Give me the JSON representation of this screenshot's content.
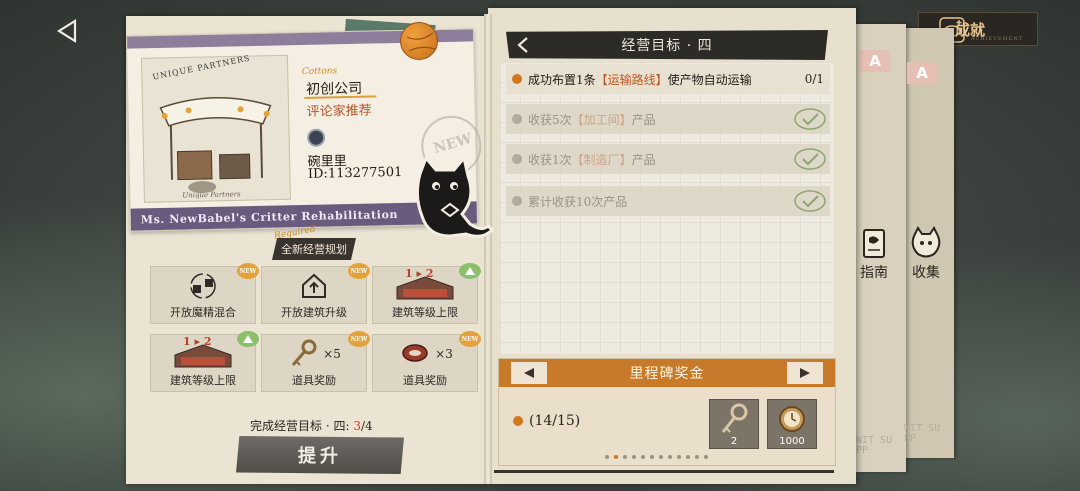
{
  "header": {
    "achievement_label": "成就",
    "achievement_sub": "ACHIEVEMENT"
  },
  "postcard": {
    "top_stamp": "UNIQUE PARTNERS",
    "company_deco": "Cottons",
    "company_name": "初创公司",
    "company_subtitle": "评论家推荐",
    "owner_name": "碗里里",
    "owner_id": "ID:113277501",
    "bottom_band": "Ms. NewBabel's Critter Rehabilitation",
    "stall_caption": "Unique Partners",
    "postmark_text": "NEW",
    "colors": {
      "accent": "#b5552b",
      "band": "#6a5a7e"
    }
  },
  "plan": {
    "deco": "Required",
    "title": "全新经营规划"
  },
  "tiles": [
    {
      "label": "开放魔精混合",
      "badge": "NEW",
      "icon": "swap-critters-icon"
    },
    {
      "label": "开放建筑升级",
      "badge": "NEW",
      "icon": "house-upgrade-icon"
    },
    {
      "label": "建筑等级上限",
      "badge": "up",
      "level": "1 ▸ 2",
      "icon": "building-level-icon"
    },
    {
      "label": "建筑等级上限",
      "badge": "up",
      "level": "1 ▸ 2",
      "icon": "building-level-icon"
    },
    {
      "label": "道具奖励",
      "badge": "NEW",
      "qty": "×5",
      "icon": "key-item-icon"
    },
    {
      "label": "道具奖励",
      "badge": "NEW",
      "qty": "×3",
      "icon": "meat-item-icon"
    }
  ],
  "completion": {
    "label": "完成经营目标 · 四: ",
    "current": "3",
    "sep": "/",
    "total": "4"
  },
  "upgrade_button": "提升",
  "goals": {
    "title": "经营目标 · 四",
    "tasks": [
      {
        "pre": "成功布置1条",
        "hl": "【运输路线】",
        "post": "使产物自动运输",
        "status": "active",
        "progress": "0/1"
      },
      {
        "pre": "收获5次",
        "hl": "【加工间】",
        "post": "产品",
        "status": "done"
      },
      {
        "pre": "收获1次",
        "hl": "【制造厂】",
        "post": "产品",
        "status": "done"
      },
      {
        "pre": "累计收获10次产品",
        "hl": "",
        "post": "",
        "status": "done"
      }
    ]
  },
  "milestone": {
    "title": "里程碑奖金",
    "progress": "(14/15)",
    "rewards": [
      {
        "icon": "key-item-icon",
        "count": "2"
      },
      {
        "icon": "pocket-watch-icon",
        "count": "1000"
      }
    ],
    "page_dots": 12,
    "active_dot": 1
  },
  "side_tabs": {
    "guide_label": "指南",
    "collect_label": "收集",
    "tab_letter": "A",
    "wit_text": "WIT SUPP"
  }
}
